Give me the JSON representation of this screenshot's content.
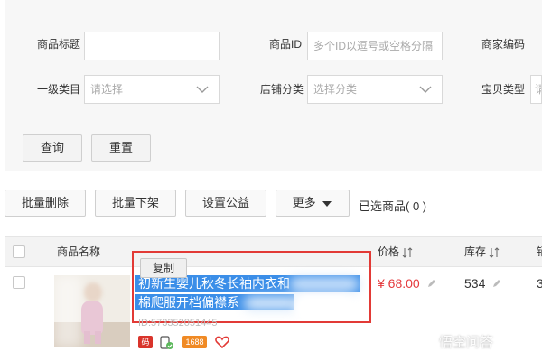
{
  "filters": {
    "title_label": "商品标题",
    "title_value": "",
    "id_label": "商品ID",
    "id_placeholder": "多个ID以逗号或空格分隔",
    "merchant_code_label": "商家编码",
    "category_label": "一级类目",
    "category_value": "请选择",
    "shop_category_label": "店铺分类",
    "shop_category_value": "选择分类",
    "item_type_label": "宝贝类型",
    "item_type_value": "请"
  },
  "actions": {
    "query": "查询",
    "reset": "重置"
  },
  "toolbar": {
    "batch_delete": "批量删除",
    "batch_offshelf": "批量下架",
    "set_charity": "设置公益",
    "more": "更多",
    "selected_text": "已选商品( 0 )"
  },
  "table": {
    "columns": {
      "name": "商品名称",
      "price": "价格",
      "stock": "库存"
    },
    "rows": [
      {
        "copy_label": "复制",
        "title_line1": "初新生婴儿秋冬长袖内衣和",
        "title_line2": "棉爬服开档偏襟系",
        "item_id": "ID:573352051445",
        "badges": [
          "码",
          "",
          "1688",
          ""
        ],
        "price": "¥ 68.00",
        "stock": "534",
        "extra": "3"
      }
    ]
  },
  "watermark": {
    "text": "悟空问答"
  },
  "colors": {
    "price_red": "#e4393c",
    "highlight_blue": "#3b8ee8",
    "annotation_red": "#e23a36"
  },
  "icons": {
    "dropdown": "chevron-down-icon",
    "more": "caret-down-icon",
    "sort": "sort-icon",
    "edit": "pencil-icon"
  }
}
